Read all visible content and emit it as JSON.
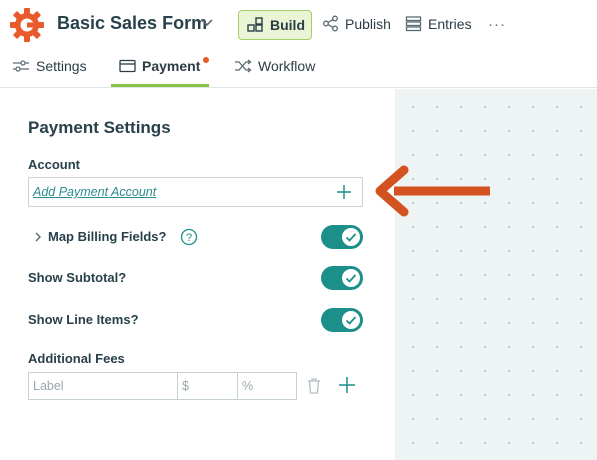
{
  "header": {
    "form_title": "Basic Sales Form",
    "build_label": "Build",
    "publish_label": "Publish",
    "entries_label": "Entries",
    "more_label": "···"
  },
  "tabs": [
    {
      "label": "Settings",
      "icon": "sliders-icon"
    },
    {
      "label": "Payment",
      "icon": "card-icon",
      "active": true
    },
    {
      "label": "Workflow",
      "icon": "shuffle-icon"
    }
  ],
  "panel": {
    "title": "Payment Settings",
    "account_label": "Account",
    "add_account_link": "Add Payment Account",
    "map_billing_label": "Map Billing Fields?",
    "map_billing_on": true,
    "show_subtotal_label": "Show Subtotal?",
    "show_subtotal_on": true,
    "show_line_items_label": "Show Line Items?",
    "show_line_items_on": true,
    "additional_fees_label": "Additional Fees",
    "fee_label_placeholder": "Label",
    "fee_amount_placeholder": "$",
    "fee_percent_placeholder": "%"
  },
  "colors": {
    "brand_orange": "#e85a2c",
    "toggle_teal": "#1d8f8a",
    "build_green": "#8bc34a",
    "link_teal": "#2a8a90",
    "arrow_orange": "#d4521f"
  }
}
